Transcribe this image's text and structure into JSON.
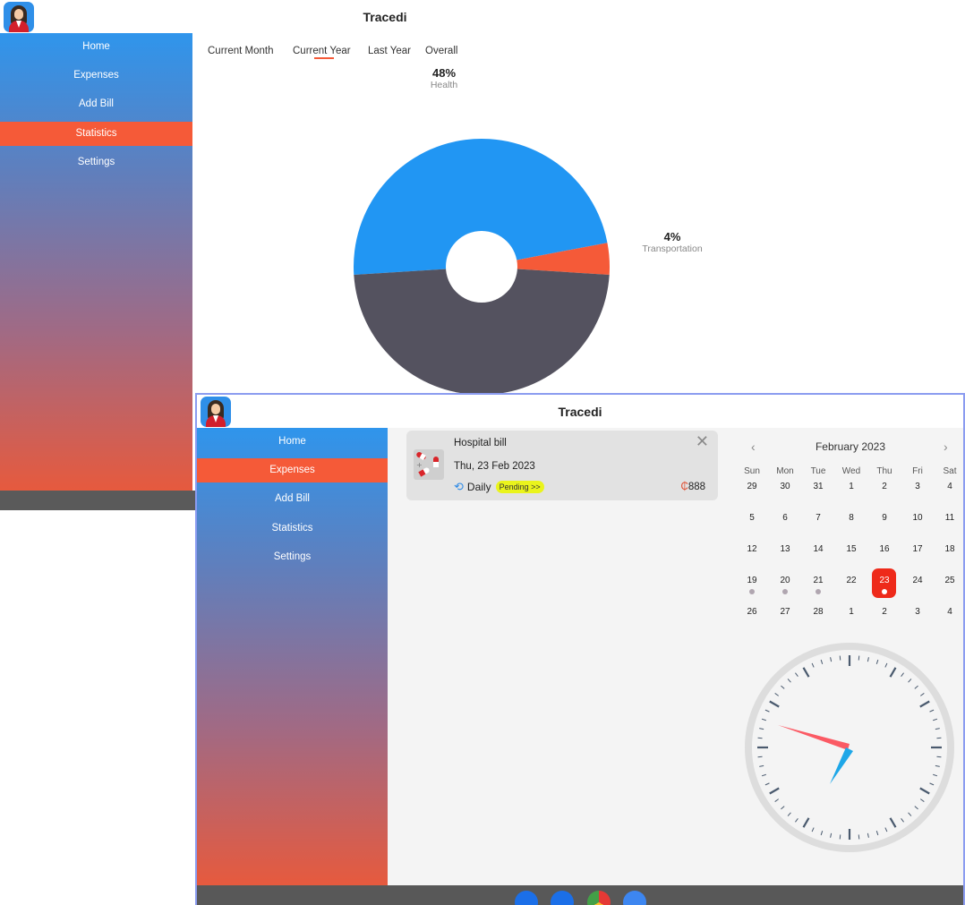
{
  "app": {
    "title": "Tracedi"
  },
  "nav": [
    "Home",
    "Expenses",
    "Add Bill",
    "Statistics",
    "Settings"
  ],
  "statistics": {
    "tabs": [
      "Current Month",
      "Current Year",
      "Last Year",
      "Overall"
    ],
    "active_tab": "Current Year",
    "labels": [
      {
        "value": "48%",
        "name": "Health"
      },
      {
        "value": "4%",
        "name": "Transportation"
      }
    ],
    "colors": {
      "blue": "#2196f3",
      "orange": "#f55a38",
      "dark": "#54525f"
    }
  },
  "expenses": {
    "bill": {
      "title": "Hospital bill",
      "date": "Thu, 23 Feb 2023",
      "repeat": "Daily",
      "status": "Pending >>",
      "currency": "₵",
      "amount": "888"
    },
    "calendar": {
      "month": "February 2023",
      "prev": "‹",
      "next": "›",
      "weekdays": [
        "Sun",
        "Mon",
        "Tue",
        "Wed",
        "Thu",
        "Fri",
        "Sat"
      ],
      "weeks": [
        [
          "29",
          "30",
          "31",
          "1",
          "2",
          "3",
          "4"
        ],
        [
          "5",
          "6",
          "7",
          "8",
          "9",
          "10",
          "11"
        ],
        [
          "12",
          "13",
          "14",
          "15",
          "16",
          "17",
          "18"
        ],
        [
          "19",
          "20",
          "21",
          "22",
          "23",
          "24",
          "25"
        ],
        [
          "26",
          "27",
          "28",
          "1",
          "2",
          "3",
          "4"
        ]
      ],
      "selected": "23"
    },
    "clock": {
      "hour_hand_color": "#fb5a64",
      "minute_hand_color": "#1ea7e8"
    }
  },
  "chart_data": {
    "type": "pie",
    "slices": [
      {
        "label": "Health",
        "value": 48,
        "color": "#2196f3"
      },
      {
        "label": "Transportation",
        "value": 4,
        "color": "#f55a38"
      },
      {
        "label": "",
        "value": 48,
        "color": "#54525f"
      }
    ]
  }
}
